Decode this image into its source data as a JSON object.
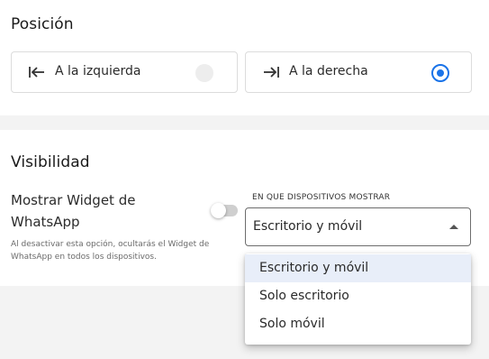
{
  "position": {
    "title": "Posición",
    "options": [
      {
        "label": "A la izquierda",
        "icon": "align-left-arrow-icon",
        "selected": false
      },
      {
        "label": "A la derecha",
        "icon": "align-right-arrow-icon",
        "selected": true
      }
    ]
  },
  "visibility": {
    "title": "Visibilidad",
    "widget_label": "Mostrar Widget de WhatsApp",
    "widget_help": "Al desactivar esta opción, ocultarás el Widget de WhatsApp en todos los dispositivos.",
    "widget_enabled": false,
    "devices_label": "EN QUE DISPOSITIVOS MOSTRAR",
    "devices_value": "Escritorio y móvil",
    "devices_options": [
      "Escritorio y móvil",
      "Solo escritorio",
      "Solo móvil"
    ]
  },
  "colors": {
    "accent": "#1a73e8",
    "selected_option_bg": "#e8eef9"
  }
}
